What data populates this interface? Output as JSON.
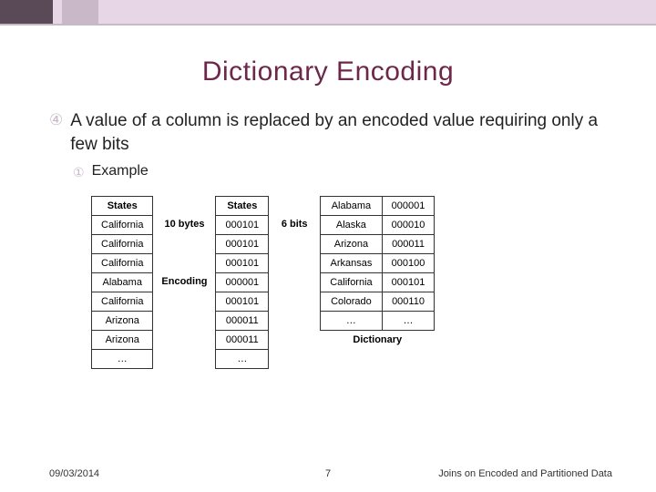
{
  "title": "Dictionary Encoding",
  "bullet_main": "A value of a column is replaced by an encoded value requiring only a few bits",
  "bullet_sub": "Example",
  "table_left": {
    "header": "States",
    "rows": [
      "California",
      "California",
      "California",
      "Alabama",
      "California",
      "Arizona",
      "Arizona",
      "…"
    ]
  },
  "annot_left": {
    "size": "10 bytes",
    "op": "Encoding"
  },
  "table_mid": {
    "header": "States",
    "rows": [
      "000101",
      "000101",
      "000101",
      "000001",
      "000101",
      "000011",
      "000011",
      "…"
    ]
  },
  "annot_right": {
    "size": "6 bits"
  },
  "dict": {
    "caption": "Dictionary",
    "rows": [
      {
        "k": "Alabama",
        "v": "000001"
      },
      {
        "k": "Alaska",
        "v": "000010"
      },
      {
        "k": "Arizona",
        "v": "000011"
      },
      {
        "k": "Arkansas",
        "v": "000100"
      },
      {
        "k": "California",
        "v": "000101"
      },
      {
        "k": "Colorado",
        "v": "000110"
      },
      {
        "k": "…",
        "v": "…"
      }
    ]
  },
  "footer": {
    "date": "09/03/2014",
    "page": "7",
    "source": "Joins on Encoded and Partitioned Data"
  }
}
